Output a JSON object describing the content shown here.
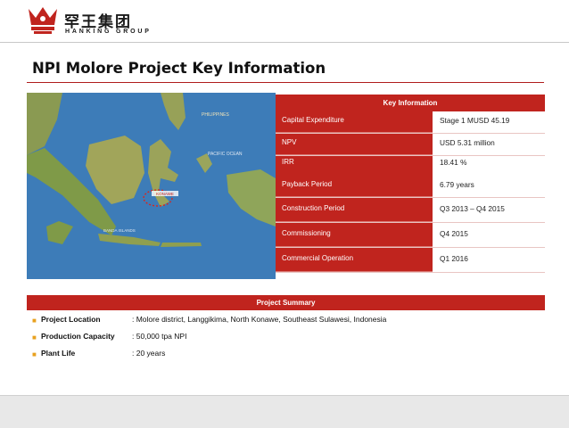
{
  "brand": {
    "name_cn": "罕王集团",
    "name_en": "HANKING GROUP"
  },
  "slide": {
    "title": "NPI Molore Project Key Information"
  },
  "map": {
    "labels": {
      "philippines": "PHILIPPINES",
      "pacific": "PACIFIC OCEAN",
      "site": "KONAWE",
      "banda": "BANDA ISLANDS"
    }
  },
  "key_info": {
    "header": "Key Information",
    "rows": [
      {
        "label": "Capital Expenditure",
        "value": "Stage 1 MUSD 45.19"
      },
      {
        "label": "NPV",
        "value": "USD 5.31 million"
      },
      {
        "label": "IRR",
        "value": "18.41 %",
        "label2": "Payback Period",
        "value2": "6.79 years"
      },
      {
        "label": "Construction Period",
        "value": "Q3 2013 – Q4 2015"
      },
      {
        "label": "Commissioning",
        "value": "Q4 2015"
      },
      {
        "label": "Commercial Operation",
        "value": "Q1 2016"
      }
    ]
  },
  "summary": {
    "header": "Project Summary",
    "items": [
      {
        "key": "Project Location",
        "value": ": Molore district, Langgikima, North Konawe, Southeast Sulawesi, Indonesia"
      },
      {
        "key": "Production Capacity",
        "value": ": 50,000 tpa NPI"
      },
      {
        "key": "Plant Life",
        "value": ": 20 years"
      }
    ]
  },
  "colors": {
    "accent": "#c0241e",
    "bullet": "#e8a11f"
  },
  "icons": {
    "logo": "crown-logo-icon",
    "bullet": "square-bullet-icon"
  }
}
